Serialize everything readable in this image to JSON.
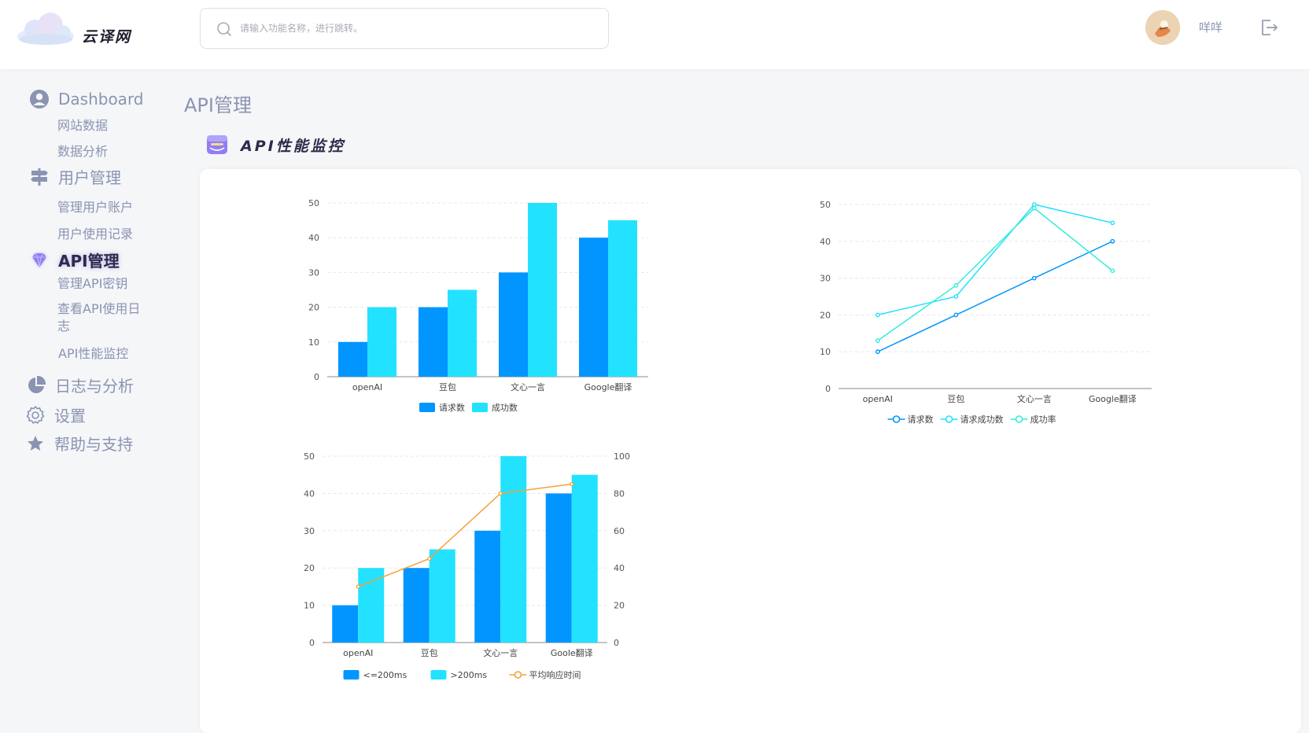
{
  "header": {
    "logo_text": "云译网",
    "search_placeholder": "请输入功能名称，进行跳转。",
    "username": "咩咩"
  },
  "sidebar": {
    "groups": [
      {
        "label": "Dashboard",
        "icon": "user-circle-icon",
        "items": [
          "网站数据",
          "数据分析"
        ]
      },
      {
        "label": "用户管理",
        "icon": "signpost-icon",
        "items": [
          "管理用户账户",
          "用户使用记录"
        ]
      },
      {
        "label": "API管理",
        "icon": "gem-icon",
        "active": true,
        "items": [
          "管理API密钥",
          "查看API使用日志",
          "API性能监控"
        ]
      },
      {
        "label": "日志与分析",
        "icon": "pie-chart-icon",
        "items": []
      },
      {
        "label": "设置",
        "icon": "gear-icon",
        "items": []
      },
      {
        "label": "帮助与支持",
        "icon": "star-icon",
        "items": []
      }
    ]
  },
  "main": {
    "page_title": "API管理",
    "section_title": "API性能监控"
  },
  "colors": {
    "blue": "#0095ff",
    "cyan": "#22e2ff",
    "teal": "#33eed8",
    "orange": "#f7a23a",
    "accent_purple": "#8f7ef5"
  },
  "chart_data": [
    {
      "type": "bar",
      "categories": [
        "openAI",
        "豆包",
        "文心一言",
        "Google翻译"
      ],
      "series": [
        {
          "name": "请求数",
          "values": [
            10,
            20,
            30,
            40
          ]
        },
        {
          "name": "成功数",
          "values": [
            20,
            25,
            50,
            45
          ]
        }
      ],
      "ylim": [
        0,
        50
      ],
      "yticks": [
        0,
        10,
        20,
        30,
        40,
        50
      ],
      "legend": "bottom",
      "grid": true
    },
    {
      "type": "line",
      "categories": [
        "openAI",
        "豆包",
        "文心一言",
        "Google翻译"
      ],
      "series": [
        {
          "name": "请求数",
          "values": [
            10,
            20,
            30,
            40
          ]
        },
        {
          "name": "请求成功数",
          "values": [
            20,
            25,
            50,
            45
          ]
        },
        {
          "name": "成功率",
          "values": [
            13,
            28,
            49,
            32
          ]
        }
      ],
      "ylim": [
        0,
        50
      ],
      "yticks": [
        0,
        10,
        20,
        30,
        40,
        50
      ],
      "legend": "bottom",
      "grid": true
    },
    {
      "type": "bar",
      "categories": [
        "openAI",
        "豆包",
        "文心一言",
        "Goole翻译"
      ],
      "series": [
        {
          "name": "<=200ms",
          "values": [
            10,
            20,
            30,
            40
          ]
        },
        {
          "name": ">200ms",
          "values": [
            20,
            25,
            50,
            45
          ]
        },
        {
          "name": "平均响应时间",
          "type": "line",
          "axis": "right",
          "values": [
            30,
            45,
            80,
            85
          ]
        }
      ],
      "ylim": [
        0,
        50
      ],
      "yticks": [
        0,
        10,
        20,
        30,
        40,
        50
      ],
      "ylim_right": [
        0,
        100
      ],
      "yticks_right": [
        0,
        20,
        40,
        60,
        80,
        100
      ],
      "legend": "bottom",
      "grid": true
    }
  ]
}
